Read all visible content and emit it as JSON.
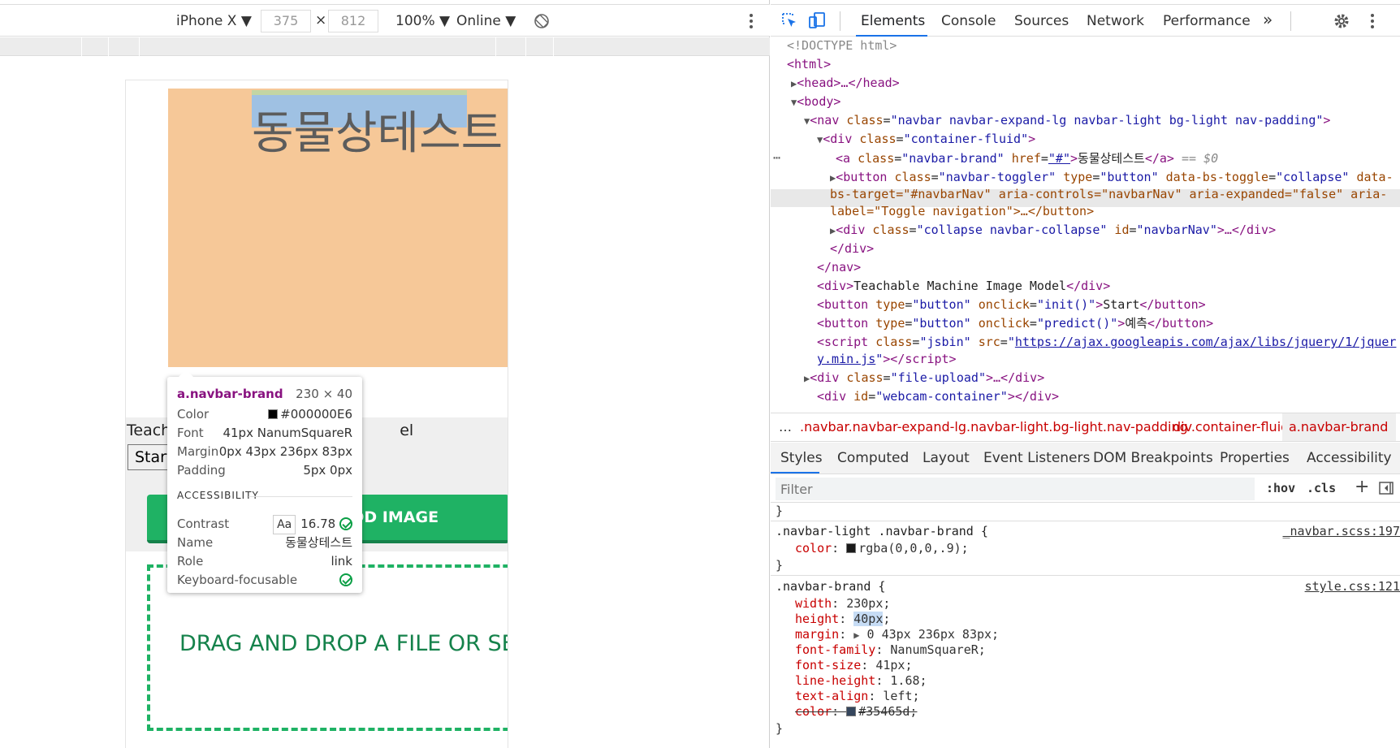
{
  "device_toolbar": {
    "device": "iPhone X ▼",
    "width": "375",
    "times": "×",
    "height": "812",
    "zoom": "100% ▼",
    "network": "Online ▼"
  },
  "page": {
    "brand_text": "동물상테스트",
    "teach_text_left": "Teach",
    "teach_text_right": "el",
    "start_button": "Start",
    "add_image_button": "ADD IMAGE",
    "drop_text": "DRAG AND DROP A FILE OR SEL"
  },
  "tooltip": {
    "tag": "a.navbar-brand",
    "size": "230 × 40",
    "rows": [
      {
        "k": "Color",
        "v": "#000000E6"
      },
      {
        "k": "Font",
        "v": "41px NanumSquareR"
      },
      {
        "k": "Margin",
        "v": "0px 43px 236px 83px"
      },
      {
        "k": "Padding",
        "v": "5px 0px"
      }
    ],
    "accessibility_heading": "ACCESSIBILITY",
    "contrast_label": "Contrast",
    "contrast_aa": "Aa",
    "contrast_value": "16.78",
    "name_label": "Name",
    "name_value": "동물상테스트",
    "role_label": "Role",
    "role_value": "link",
    "focus_label": "Keyboard-focusable"
  },
  "devtools_tabs": [
    "Elements",
    "Console",
    "Sources",
    "Network",
    "Performance"
  ],
  "more_tabs": "»",
  "dom": {
    "doctype": "<!DOCTYPE html>",
    "html_open": "<html>",
    "head": "<head>…</head>",
    "body_open": "<body>",
    "nav_tag": "<nav",
    "nav_attr": "class",
    "nav_class": "\"navbar navbar-expand-lg navbar-light bg-light nav-padding\"",
    "div_container": "\"container-fluid\"",
    "a_class": "\"navbar-brand\"",
    "a_href": "\"#\"",
    "a_text": "동물상테스트",
    "a_eq": "== $0",
    "btn_toggler_1": "\"navbar-toggler\"",
    "btn_toggler_type": "\"button\"",
    "btn_toggler_bs": "\"collapse\"",
    "line2": "bs-target=\"#navbarNav\" aria-controls=\"navbarNav\" aria-expanded=\"false\" aria-",
    "line3": "label=\"Toggle navigation\">…</button>",
    "collapse_class": "\"collapse navbar-collapse\"",
    "collapse_id": "\"navbarNav\"",
    "div_close": "</div>",
    "nav_close": "</nav>",
    "tm_text": "Teachable Machine Image Model",
    "btn_start_onclick": "\"init()\"",
    "btn_start_text": "Start",
    "btn_predict_onclick": "\"predict()\"",
    "btn_predict_text": "예측",
    "script_class": "\"jsbin\"",
    "script_src_1": "https://ajax.googleapis.com/ajax/libs/jquery/1/jquer",
    "script_src_2": "y.min.js",
    "file_upload_class": "\"file-upload\"",
    "webcam_id": "\"webcam-container\""
  },
  "breadcrumbs": [
    ".navbar.navbar-expand-lg.navbar-light.bg-light.nav-padding",
    "div.container-fluid",
    "a.navbar-brand"
  ],
  "breadcrumb_ellipsis": "…",
  "style_tabs": [
    "Styles",
    "Computed",
    "Layout",
    "Event Listeners",
    "DOM Breakpoints",
    "Properties",
    "Accessibility"
  ],
  "filter": {
    "placeholder": "Filter",
    "hov": ":hov",
    "cls": ".cls",
    "plus": "+"
  },
  "rules": {
    "brace_close": "}",
    "r1_selector": ".navbar-light .navbar-brand {",
    "r1_source": "_navbar.scss:197",
    "r1_prop": "color",
    "r1_value": "rgba(0,0,0,.9);",
    "r2_selector": ".navbar-brand {",
    "r2_source": "style.css:121",
    "r2_props": [
      {
        "p": "width",
        "v": "230px;"
      },
      {
        "p": "height",
        "v": "40px"
      },
      {
        "p": "margin",
        "v": "0 43px 236px 83px;"
      },
      {
        "p": "font-family",
        "v": "NanumSquareR;"
      },
      {
        "p": "font-size",
        "v": "41px;"
      },
      {
        "p": "line-height",
        "v": "1.68;"
      },
      {
        "p": "text-align",
        "v": "left;"
      },
      {
        "p": "color",
        "v": "#35465d;"
      }
    ]
  }
}
